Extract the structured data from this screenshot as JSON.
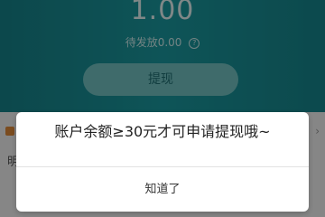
{
  "wallet": {
    "balance": "1.00",
    "pending_label": "待发放0.00",
    "help_glyph": "?",
    "withdraw_button": "提现"
  },
  "list": {
    "row_text_partial": "明"
  },
  "dialog": {
    "message": "账户余额≥30元才可申请提现哦~",
    "ok_button": "知道了"
  },
  "colors": {
    "header": "#1a9aa0",
    "withdraw_button": "#74c4c4",
    "overlay": "rgba(0,0,0,0.45)"
  }
}
